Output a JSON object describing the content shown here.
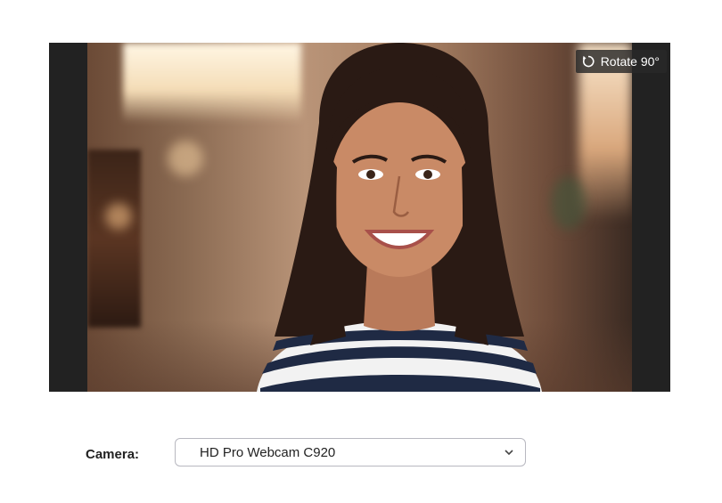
{
  "preview": {
    "rotate_label": "Rotate 90°",
    "rotate_icon": "rotate-icon"
  },
  "camera": {
    "label": "Camera:",
    "selected": "HD Pro Webcam C920",
    "dropdown_icon": "chevron-down-icon"
  },
  "colors": {
    "letterbox": "#222222",
    "overlay": "#282828",
    "select_border": "#b8b8c0"
  }
}
